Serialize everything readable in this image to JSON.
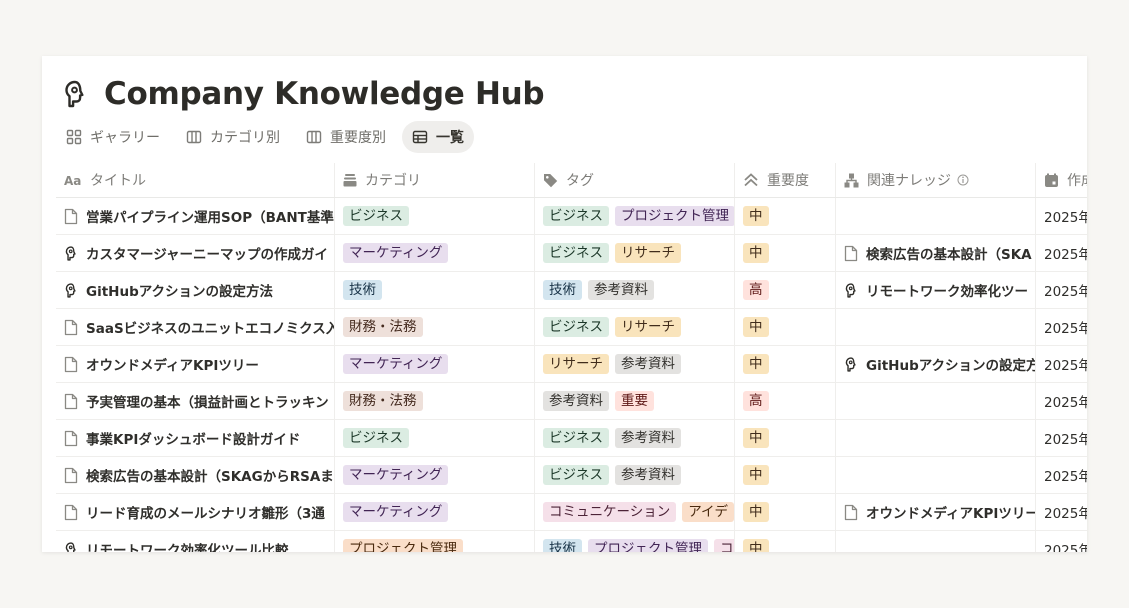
{
  "page": {
    "title": "Company Knowledge Hub",
    "title_icon": "brain-head-icon"
  },
  "tabs": [
    {
      "label": "ギャラリー",
      "icon": "gallery-grid-icon",
      "active": false
    },
    {
      "label": "カテゴリ別",
      "icon": "board-columns-icon",
      "active": false
    },
    {
      "label": "重要度別",
      "icon": "board-columns-icon",
      "active": false
    },
    {
      "label": "一覧",
      "icon": "table-icon",
      "active": true
    }
  ],
  "columns": [
    {
      "label": "タイトル",
      "icon": "text-aa-icon"
    },
    {
      "label": "カテゴリ",
      "icon": "select-stack-icon"
    },
    {
      "label": "タグ",
      "icon": "tag-icon"
    },
    {
      "label": "重要度",
      "icon": "double-chevron-up-icon"
    },
    {
      "label": "関連ナレッジ",
      "icon": "relation-icon"
    },
    {
      "label": "作成",
      "icon": "calendar-icon"
    }
  ],
  "colors": {
    "green": "#dbece2",
    "purple": "#e8deee",
    "blue": "#d3e5ef",
    "brown": "#eee0da",
    "yellow": "#f9e4bc",
    "gray": "#e3e2e0",
    "pink": "#f5e0e9",
    "red": "#ffe2dd",
    "orange": "#fadec9"
  },
  "rows": [
    {
      "title": "営業パイプライン運用SOP（BANT基準",
      "icon": "page-icon",
      "category": {
        "label": "ビジネス",
        "color": "green"
      },
      "tags": [
        {
          "label": "ビジネス",
          "color": "green"
        },
        {
          "label": "プロジェクト管理",
          "color": "purple"
        }
      ],
      "importance": {
        "label": "中",
        "color": "yellow"
      },
      "related": null,
      "date": "2025年"
    },
    {
      "title": "カスタマージャーニーマップの作成ガイ",
      "icon": "brain-head-icon",
      "category": {
        "label": "マーケティング",
        "color": "purple"
      },
      "tags": [
        {
          "label": "ビジネス",
          "color": "green"
        },
        {
          "label": "リサーチ",
          "color": "yellow"
        }
      ],
      "importance": {
        "label": "中",
        "color": "yellow"
      },
      "related": {
        "label": "検索広告の基本設計（SKA",
        "icon": "page-icon"
      },
      "date": "2025年"
    },
    {
      "title": "GitHubアクションの設定方法",
      "icon": "brain-head-icon",
      "category": {
        "label": "技術",
        "color": "blue"
      },
      "tags": [
        {
          "label": "技術",
          "color": "blue"
        },
        {
          "label": "参考資料",
          "color": "gray"
        }
      ],
      "importance": {
        "label": "高",
        "color": "red"
      },
      "related": {
        "label": "リモートワーク効率化ツー",
        "icon": "brain-head-icon"
      },
      "date": "2025年"
    },
    {
      "title": "SaaSビジネスのユニットエコノミクス入",
      "icon": "page-icon",
      "category": {
        "label": "財務・法務",
        "color": "brown"
      },
      "tags": [
        {
          "label": "ビジネス",
          "color": "green"
        },
        {
          "label": "リサーチ",
          "color": "yellow"
        }
      ],
      "importance": {
        "label": "中",
        "color": "yellow"
      },
      "related": null,
      "date": "2025年"
    },
    {
      "title": "オウンドメディアKPIツリー",
      "icon": "page-icon",
      "category": {
        "label": "マーケティング",
        "color": "purple"
      },
      "tags": [
        {
          "label": "リサーチ",
          "color": "yellow"
        },
        {
          "label": "参考資料",
          "color": "gray"
        }
      ],
      "importance": {
        "label": "中",
        "color": "yellow"
      },
      "related": {
        "label": "GitHubアクションの設定方",
        "icon": "brain-head-icon"
      },
      "date": "2025年"
    },
    {
      "title": "予実管理の基本（損益計画とトラッキン",
      "icon": "page-icon",
      "category": {
        "label": "財務・法務",
        "color": "brown"
      },
      "tags": [
        {
          "label": "参考資料",
          "color": "gray"
        },
        {
          "label": "重要",
          "color": "red"
        }
      ],
      "importance": {
        "label": "高",
        "color": "red"
      },
      "related": null,
      "date": "2025年"
    },
    {
      "title": "事業KPIダッシュボード設計ガイド",
      "icon": "page-icon",
      "category": {
        "label": "ビジネス",
        "color": "green"
      },
      "tags": [
        {
          "label": "ビジネス",
          "color": "green"
        },
        {
          "label": "参考資料",
          "color": "gray"
        }
      ],
      "importance": {
        "label": "中",
        "color": "yellow"
      },
      "related": null,
      "date": "2025年"
    },
    {
      "title": "検索広告の基本設計（SKAGからRSAま",
      "icon": "page-icon",
      "category": {
        "label": "マーケティング",
        "color": "purple"
      },
      "tags": [
        {
          "label": "ビジネス",
          "color": "green"
        },
        {
          "label": "参考資料",
          "color": "gray"
        }
      ],
      "importance": {
        "label": "中",
        "color": "yellow"
      },
      "related": null,
      "date": "2025年"
    },
    {
      "title": "リード育成のメールシナリオ雛形（3通",
      "icon": "page-icon",
      "category": {
        "label": "マーケティング",
        "color": "purple"
      },
      "tags": [
        {
          "label": "コミュニケーション",
          "color": "pink"
        },
        {
          "label": "アイデ",
          "color": "orange"
        }
      ],
      "importance": {
        "label": "中",
        "color": "yellow"
      },
      "related": {
        "label": "オウンドメディアKPIツリー",
        "icon": "page-icon"
      },
      "date": "2025年"
    },
    {
      "title": "リモートワーク効率化ツール比較",
      "icon": "brain-head-icon",
      "category": {
        "label": "プロジェクト管理",
        "color": "orange"
      },
      "tags": [
        {
          "label": "技術",
          "color": "blue"
        },
        {
          "label": "プロジェクト管理",
          "color": "purple"
        },
        {
          "label": "コ",
          "color": "pink"
        }
      ],
      "importance": {
        "label": "中",
        "color": "yellow"
      },
      "related": null,
      "date": "2025年"
    }
  ]
}
